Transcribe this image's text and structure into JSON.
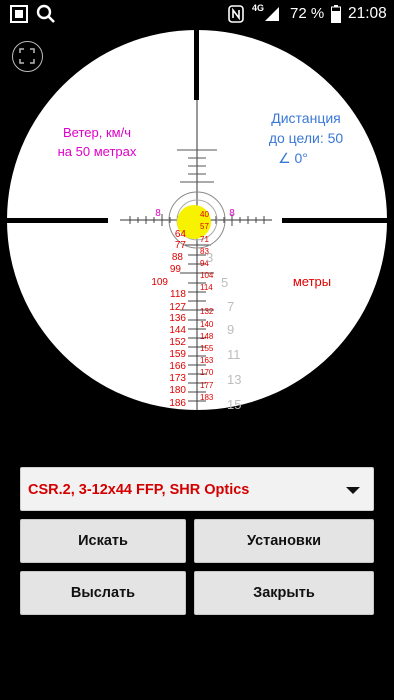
{
  "status_bar": {
    "network": "4G",
    "battery": "72 %",
    "time": "21:08"
  },
  "scope": {
    "wind_label_line1": "Ветер, км/ч",
    "wind_label_line2": "на 50 метрах",
    "distance_line1": "Дистанция",
    "distance_line2": "до цели: 50",
    "distance_line3": "∠ 0°",
    "meters_label": "метры",
    "wind_marks": [
      "8",
      "8"
    ],
    "hold_labels_left": [
      "64",
      "77",
      "88",
      "99",
      "109",
      "118",
      "127",
      "136",
      "144",
      "152",
      "159",
      "166",
      "173",
      "180",
      "186"
    ],
    "hold_labels_right": [
      "40",
      "57",
      "71",
      "83",
      "94",
      "104",
      "114",
      "132",
      "140",
      "148",
      "155",
      "163",
      "170",
      "177",
      "183"
    ],
    "mil_labels": [
      "3",
      "5",
      "7",
      "9",
      "11",
      "13",
      "15"
    ]
  },
  "controls": {
    "reticle_select": "CSR.2, 3-12x44 FFP, SHR Optics",
    "search_button": "Искать",
    "settings_button": "Установки",
    "send_button": "Выслать",
    "close_button": "Закрыть"
  },
  "colors": {
    "hold_marks": "#e00000",
    "wind_label": "#e000c8",
    "distance_label": "#3a78d6",
    "target_dot": "#f6f200"
  }
}
